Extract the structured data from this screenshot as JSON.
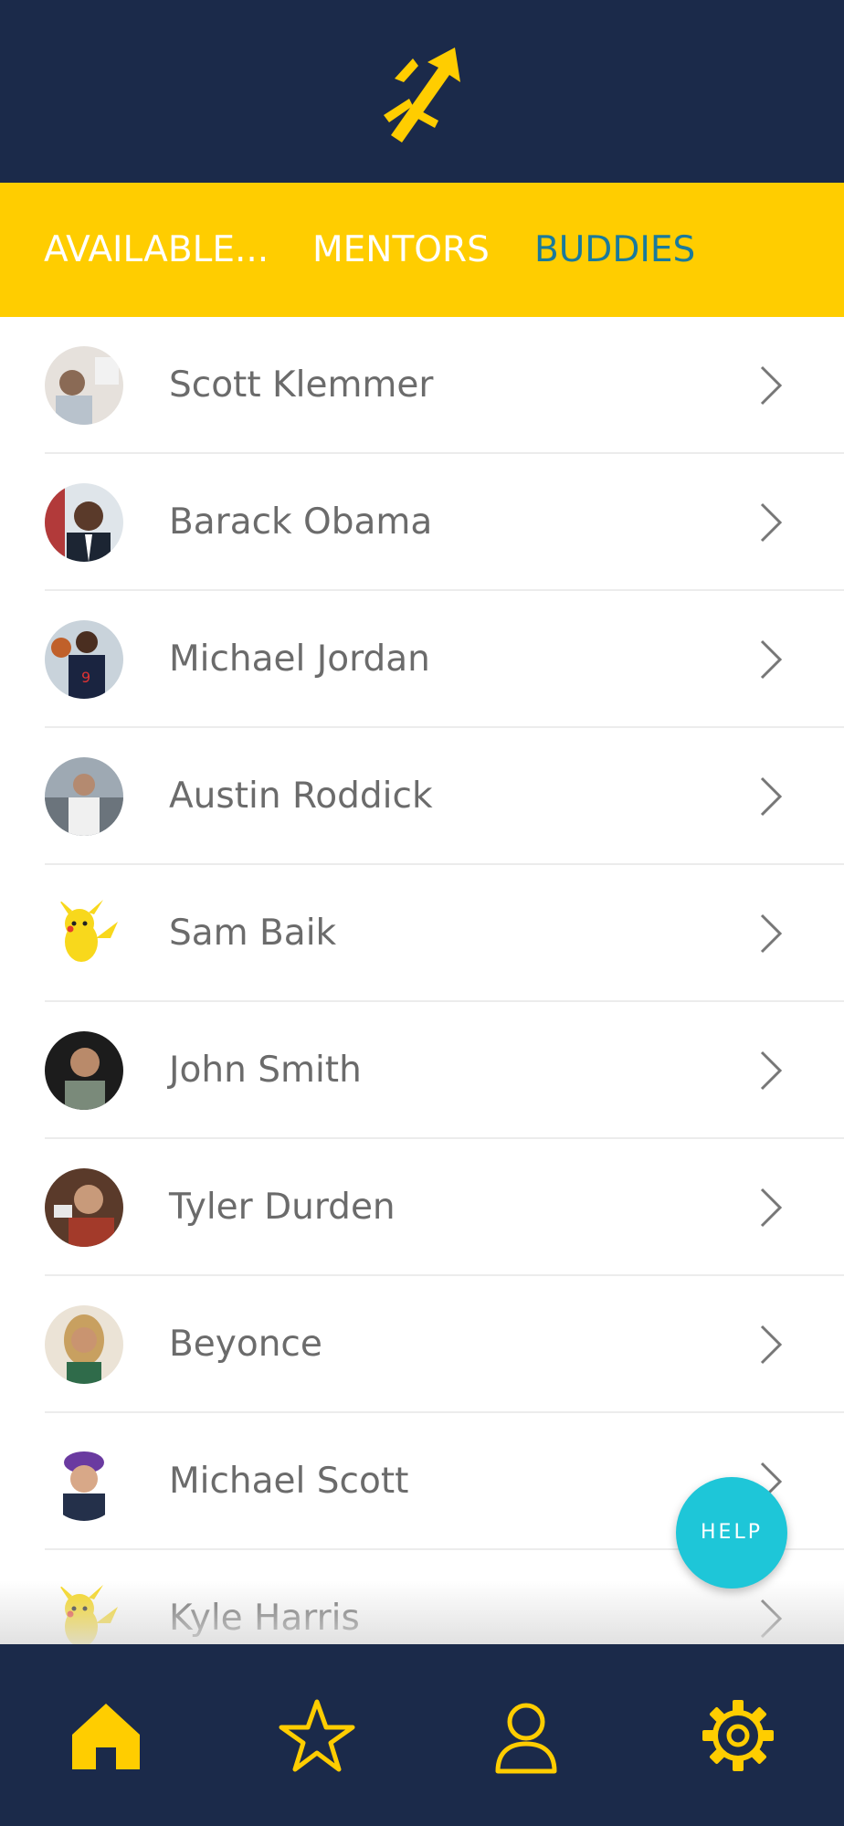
{
  "header": {
    "logo_icon": "trident-logo-icon"
  },
  "tabs": [
    {
      "label": "AVAILABLE...",
      "active": false
    },
    {
      "label": "MENTORS",
      "active": false
    },
    {
      "label": "BUDDIES",
      "active": true
    }
  ],
  "contacts": [
    {
      "name": "Scott Klemmer",
      "avatar": "photo"
    },
    {
      "name": "Barack Obama",
      "avatar": "photo"
    },
    {
      "name": "Michael Jordan",
      "avatar": "photo"
    },
    {
      "name": "Austin Roddick",
      "avatar": "photo"
    },
    {
      "name": "Sam Baik",
      "avatar": "pikachu"
    },
    {
      "name": "John Smith",
      "avatar": "photo"
    },
    {
      "name": "Tyler Durden",
      "avatar": "photo"
    },
    {
      "name": "Beyonce",
      "avatar": "photo"
    },
    {
      "name": "Michael Scott",
      "avatar": "photo"
    },
    {
      "name": "Kyle Harris",
      "avatar": "pikachu"
    }
  ],
  "help_button": {
    "label": "HELP"
  },
  "bottom_nav": [
    {
      "icon": "home-icon"
    },
    {
      "icon": "star-icon"
    },
    {
      "icon": "profile-icon"
    },
    {
      "icon": "gear-icon"
    }
  ],
  "colors": {
    "navy": "#1b2a4a",
    "yellow": "#ffcd00",
    "active_tab": "#1a7a9c",
    "help": "#1ec6d8",
    "text": "#6b6b6b"
  }
}
